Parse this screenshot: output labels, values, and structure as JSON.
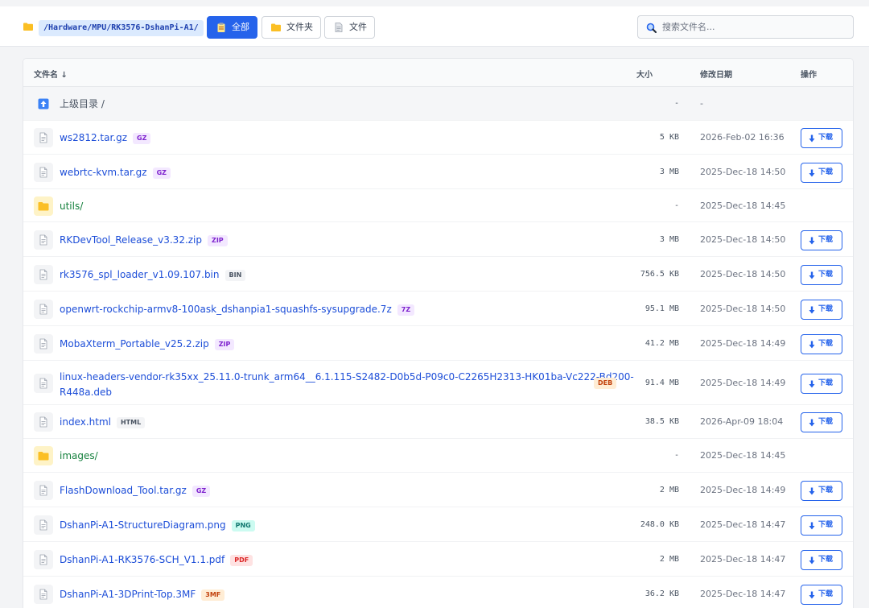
{
  "breadcrumb": {
    "path": "/Hardware/MPU/RK3576-DshanPi-A1/"
  },
  "filters": [
    {
      "label": "全部",
      "icon": "clipboard-icon",
      "active": true
    },
    {
      "label": "文件夹",
      "icon": "folder-icon",
      "active": false
    },
    {
      "label": "文件",
      "icon": "file-icon",
      "active": false
    }
  ],
  "search": {
    "placeholder": "搜索文件名..."
  },
  "table": {
    "headers": {
      "name": "文件名 ↓",
      "size": "大小",
      "date": "修改日期",
      "action": "操作"
    },
    "download_label": "下载",
    "rows": [
      {
        "type": "parent",
        "name": "上级目录 /",
        "size": "-",
        "date": "-"
      },
      {
        "type": "file",
        "name": "ws2812.tar.gz",
        "badge": "GZ",
        "size": "5 KB",
        "date": "2026-Feb-02 16:36"
      },
      {
        "type": "file",
        "name": "webrtc-kvm.tar.gz",
        "badge": "GZ",
        "size": "3 MB",
        "date": "2025-Dec-18 14:50"
      },
      {
        "type": "dir",
        "name": "utils/",
        "size": "-",
        "date": "2025-Dec-18 14:45"
      },
      {
        "type": "file",
        "name": "RKDevTool_Release_v3.32.zip",
        "badge": "ZIP",
        "size": "3 MB",
        "date": "2025-Dec-18 14:50"
      },
      {
        "type": "file",
        "name": "rk3576_spl_loader_v1.09.107.bin",
        "badge": "BIN",
        "size": "756.5 KB",
        "date": "2025-Dec-18 14:50"
      },
      {
        "type": "file",
        "name": "openwrt-rockchip-armv8-100ask_dshanpia1-squashfs-sysupgrade.7z",
        "badge": "7Z",
        "size": "95.1 MB",
        "date": "2025-Dec-18 14:50"
      },
      {
        "type": "file",
        "name": "MobaXterm_Portable_v25.2.zip",
        "badge": "ZIP",
        "size": "41.2 MB",
        "date": "2025-Dec-18 14:49"
      },
      {
        "type": "file",
        "name": "linux-headers-vendor-rk35xx_25.11.0-trunk_arm64__6.1.115-S2482-D0b5d-P09c0-C2265H2313-HK01ba-Vc222-Bd200-R448a.deb",
        "name_line1": "linux-headers-vendor-rk35xx_25.11.0-trunk_arm64__6.1.115-S2482-D0b5d-P09c0-C2265H2313-HK01ba-Vc222-Bd200-",
        "name_line2": "R448a.deb",
        "badge": "DEB",
        "size": "91.4 MB",
        "date": "2025-Dec-18 14:49"
      },
      {
        "type": "file",
        "name": "index.html",
        "badge": "HTML",
        "size": "38.5 KB",
        "date": "2026-Apr-09 18:04"
      },
      {
        "type": "dir",
        "name": "images/",
        "size": "-",
        "date": "2025-Dec-18 14:45"
      },
      {
        "type": "file",
        "name": "FlashDownload_Tool.tar.gz",
        "badge": "GZ",
        "size": "2 MB",
        "date": "2025-Dec-18 14:49"
      },
      {
        "type": "file",
        "name": "DshanPi-A1-StructureDiagram.png",
        "badge": "PNG",
        "size": "248.0 KB",
        "date": "2025-Dec-18 14:47"
      },
      {
        "type": "file",
        "name": "DshanPi-A1-RK3576-SCH_V1.1.pdf",
        "badge": "PDF",
        "size": "2 MB",
        "date": "2025-Dec-18 14:47"
      },
      {
        "type": "file",
        "name": "DshanPi-A1-3DPrint-Top.3MF",
        "badge": "3MF",
        "size": "36.2 KB",
        "date": "2025-Dec-18 14:47"
      }
    ]
  },
  "colors": {
    "accent": "#2563eb",
    "file_link": "#1d4ed8",
    "folder_link": "#15803d",
    "folder_icon": "#fbbf24",
    "parent_icon": "#3b82f6"
  }
}
